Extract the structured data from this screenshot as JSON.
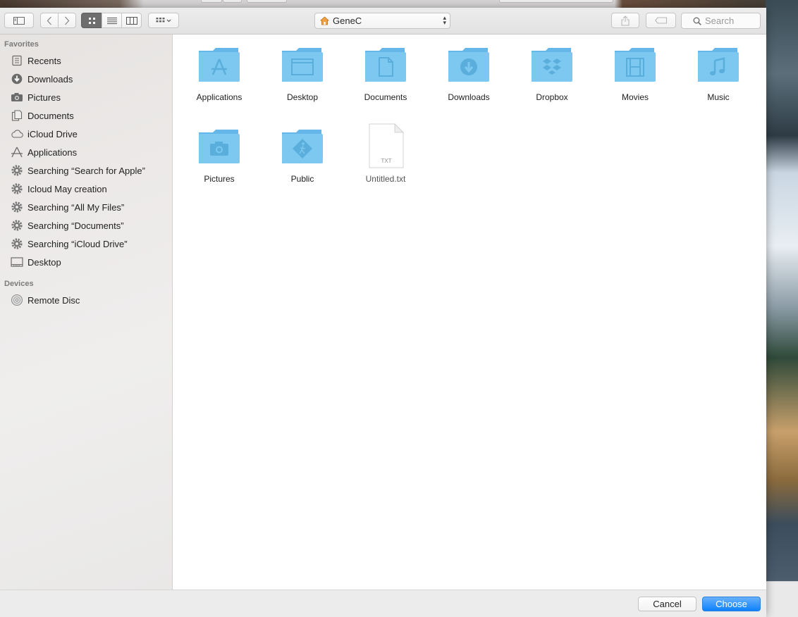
{
  "toolbar": {
    "sidebar_toggle_icon": "sidebar-icon",
    "back_icon": "chevron-left-icon",
    "forward_icon": "chevron-right-icon",
    "view_modes": [
      "icon-view",
      "list-view",
      "column-view"
    ],
    "active_view": "icon-view",
    "arrange_icon": "grid-arrange-icon",
    "path_label": "GeneC",
    "share_icon": "share-icon",
    "tag_icon": "tag-icon",
    "search_placeholder": "Search"
  },
  "sidebar": {
    "favorites_header": "Favorites",
    "favorites": [
      {
        "label": "Recents",
        "icon": "recents-icon"
      },
      {
        "label": "Downloads",
        "icon": "downloads-icon"
      },
      {
        "label": "Pictures",
        "icon": "camera-icon"
      },
      {
        "label": "Documents",
        "icon": "documents-icon"
      },
      {
        "label": "iCloud Drive",
        "icon": "cloud-icon"
      },
      {
        "label": "Applications",
        "icon": "applications-icon"
      },
      {
        "label": "Searching “Search for Apple”",
        "icon": "gear-icon"
      },
      {
        "label": "Icloud May creation",
        "icon": "gear-icon"
      },
      {
        "label": "Searching “All My Files”",
        "icon": "gear-icon"
      },
      {
        "label": "Searching “Documents”",
        "icon": "gear-icon"
      },
      {
        "label": "Searching “iCloud Drive”",
        "icon": "gear-icon"
      },
      {
        "label": "Desktop",
        "icon": "desktop-icon"
      }
    ],
    "devices_header": "Devices",
    "devices": [
      {
        "label": "Remote Disc",
        "icon": "disc-icon"
      }
    ]
  },
  "files": [
    {
      "label": "Applications",
      "icon": "folder-applications-icon"
    },
    {
      "label": "Desktop",
      "icon": "folder-desktop-icon"
    },
    {
      "label": "Documents",
      "icon": "folder-documents-icon"
    },
    {
      "label": "Downloads",
      "icon": "folder-downloads-icon"
    },
    {
      "label": "Dropbox",
      "icon": "folder-dropbox-icon"
    },
    {
      "label": "Movies",
      "icon": "folder-movies-icon"
    },
    {
      "label": "Music",
      "icon": "folder-music-icon"
    },
    {
      "label": "Pictures",
      "icon": "folder-pictures-icon"
    },
    {
      "label": "Public",
      "icon": "folder-public-icon"
    },
    {
      "label": "Untitled.txt",
      "icon": "text-file-icon",
      "badge": "TXT"
    }
  ],
  "buttons": {
    "cancel": "Cancel",
    "choose": "Choose"
  },
  "colors": {
    "folder": "#7cc8f0",
    "accent": "#0d81ff"
  }
}
